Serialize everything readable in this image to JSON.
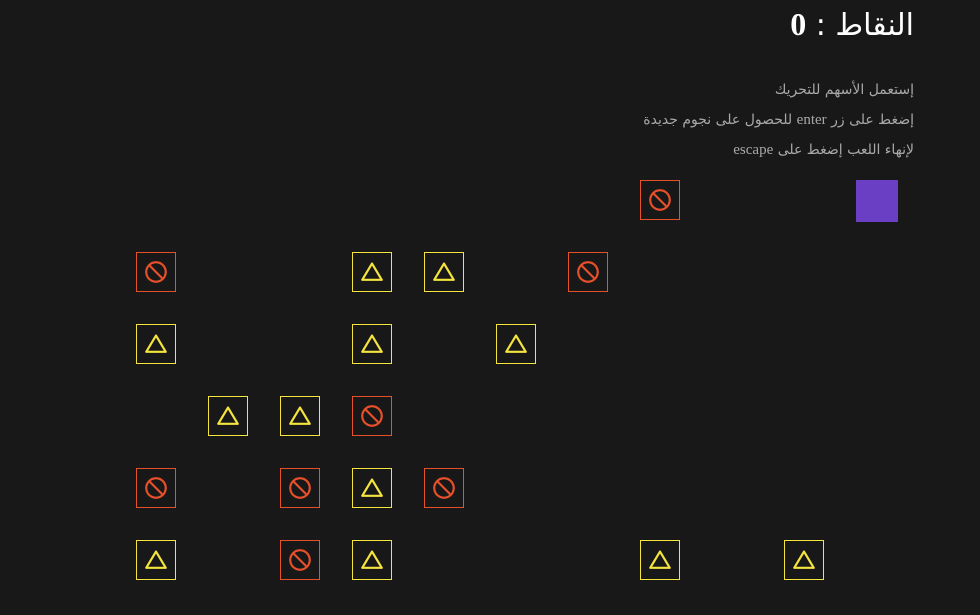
{
  "score": {
    "label": "النقاط :",
    "value": "0"
  },
  "instructions": {
    "line1": "إستعمل الأسهم للتحريك",
    "line2_before": "إضغط على زر",
    "line2_key": "enter",
    "line2_after": "للحصول على نجوم جديدة",
    "line3_before": "لإنهاء اللعب إضغط على",
    "line3_key": "escape"
  },
  "colors": {
    "background": "#181818",
    "star": "#f5e43d",
    "block": "#e6502a",
    "player": "#6a3fc4",
    "instructions": "#a8a8a8"
  },
  "icons": {
    "star": "warning-triangle-icon",
    "block": "prohibited-circle-icon"
  },
  "board": {
    "tiles": [
      {
        "type": "block",
        "col": 7,
        "row": 0
      },
      {
        "type": "block",
        "col": 0,
        "row": 1
      },
      {
        "type": "star",
        "col": 3,
        "row": 1
      },
      {
        "type": "star",
        "col": 4,
        "row": 1
      },
      {
        "type": "block",
        "col": 6,
        "row": 1
      },
      {
        "type": "star",
        "col": 0,
        "row": 2
      },
      {
        "type": "star",
        "col": 3,
        "row": 2
      },
      {
        "type": "star",
        "col": 5,
        "row": 2
      },
      {
        "type": "star",
        "col": 1,
        "row": 3
      },
      {
        "type": "star",
        "col": 2,
        "row": 3
      },
      {
        "type": "block",
        "col": 3,
        "row": 3
      },
      {
        "type": "block",
        "col": 0,
        "row": 4
      },
      {
        "type": "block",
        "col": 2,
        "row": 4
      },
      {
        "type": "star",
        "col": 3,
        "row": 4
      },
      {
        "type": "block",
        "col": 4,
        "row": 4
      },
      {
        "type": "star",
        "col": 0,
        "row": 5
      },
      {
        "type": "block",
        "col": 2,
        "row": 5
      },
      {
        "type": "star",
        "col": 3,
        "row": 5
      },
      {
        "type": "star",
        "col": 7,
        "row": 5
      },
      {
        "type": "star",
        "col": 9,
        "row": 5
      }
    ],
    "player": {
      "col": 10,
      "row": 0
    }
  }
}
